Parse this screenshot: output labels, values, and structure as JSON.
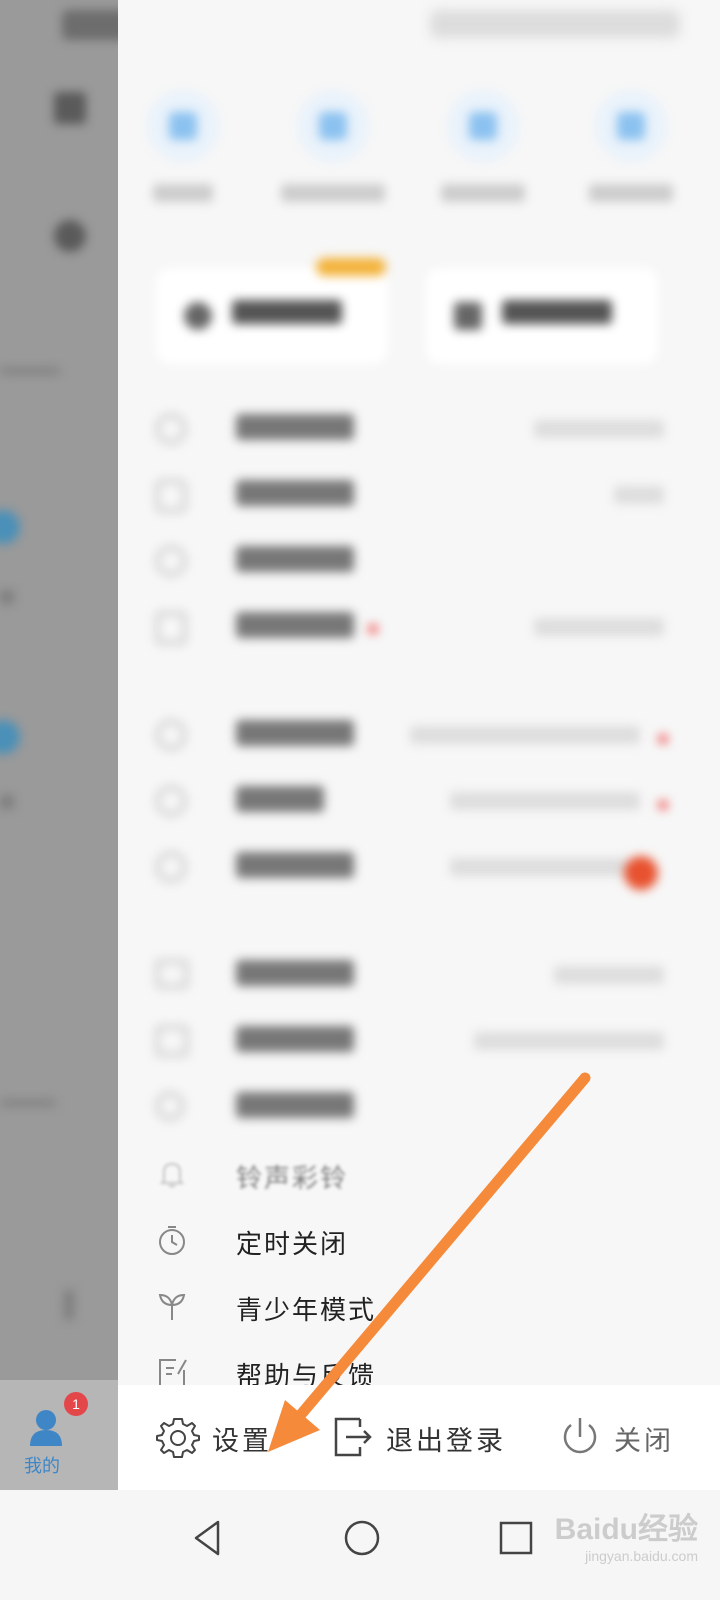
{
  "bottom_tab": {
    "label": "我的",
    "badge": "1"
  },
  "menu": {
    "items": [
      {
        "label": "铃声彩铃",
        "icon": "bell-icon"
      },
      {
        "label": "定时关闭",
        "icon": "timer-icon"
      },
      {
        "label": "青少年模式",
        "icon": "sprout-icon"
      },
      {
        "label": "帮助与反馈",
        "icon": "feedback-icon"
      }
    ]
  },
  "action_bar": {
    "settings_label": "设置",
    "logout_label": "退出登录",
    "close_label": "关闭"
  },
  "watermark": {
    "main": "Baidu经验",
    "sub": "jingyan.baidu.com"
  },
  "colors": {
    "annotation_arrow": "#f58a3a",
    "badge": "#e4474a",
    "tab_active": "#3f86c7"
  }
}
